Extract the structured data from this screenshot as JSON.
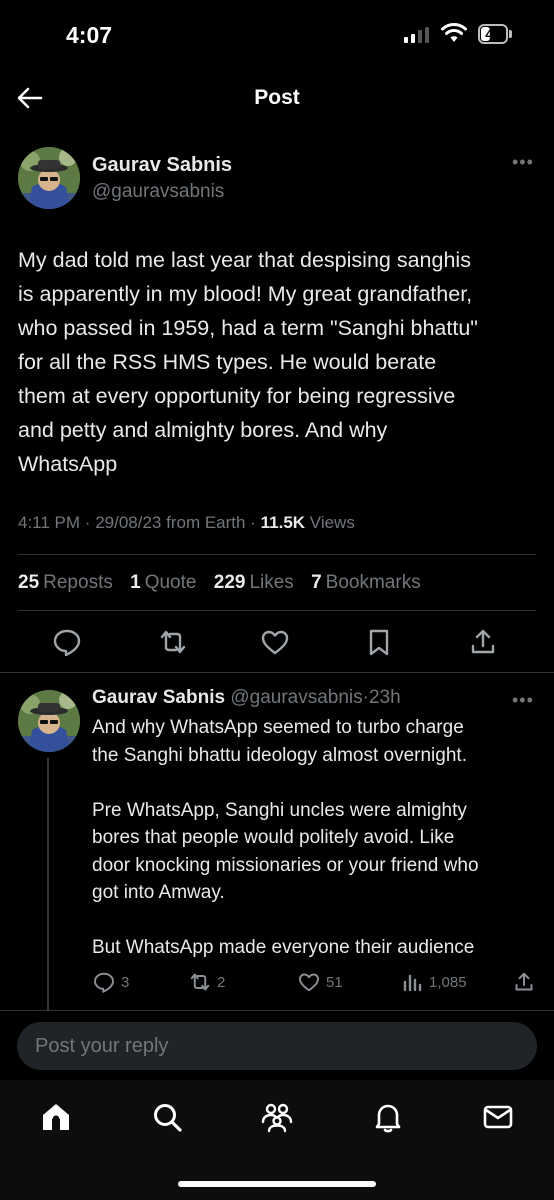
{
  "status_bar": {
    "time": "4:07",
    "battery": "44",
    "battery_level": 0.44
  },
  "header": {
    "title": "Post"
  },
  "post": {
    "author_name": "Gaurav Sabnis",
    "author_handle": "@gauravsabnis",
    "text_lines": [
      "My dad told me last year that despising sanghis",
      "is apparently in my blood! My great grandfather,",
      "who passed in 1959, had a term \"Sanghi bhattu\"",
      "for all the RSS HMS types. He would berate",
      "them at every opportunity for being regressive",
      "and petty and almighty bores. And why",
      "WhatsApp"
    ],
    "time": "4:11 PM",
    "date": "29/08/23",
    "source": "from Earth",
    "views_count": "11.5K",
    "views_label": "Views",
    "separator": "·",
    "stats": {
      "reposts_count": "25",
      "reposts_label": "Reposts",
      "quotes_count": "1",
      "quotes_label": "Quote",
      "likes_count": "229",
      "likes_label": "Likes",
      "bookmarks_count": "7",
      "bookmarks_label": "Bookmarks"
    }
  },
  "reply": {
    "author_name": "Gaurav Sabnis",
    "author_handle": "@gauravsabnis",
    "time_ago": "23h",
    "separator": "·",
    "paragraphs": [
      [
        "And why WhatsApp seemed to turbo charge",
        "the Sanghi bhattu ideology almost overnight."
      ],
      [
        "Pre WhatsApp, Sanghi uncles were almighty",
        "bores that people would politely avoid. Like",
        "door knocking missionaries or your friend who",
        "got into Amway."
      ],
      [
        "But WhatsApp made everyone their audience"
      ]
    ],
    "replies": "3",
    "reposts": "2",
    "likes": "51",
    "views": "1,085"
  },
  "reply_input": {
    "placeholder": "Post your reply"
  },
  "icons": {
    "back": "arrow-left-icon",
    "more": "more-icon",
    "reply": "comment-icon",
    "repost": "repost-icon",
    "like": "heart-icon",
    "bookmark": "bookmark-icon",
    "share": "share-icon",
    "views": "analytics-icon",
    "home": "home-icon",
    "search": "search-icon",
    "communities": "people-icon",
    "notifications": "bell-icon",
    "messages": "mail-icon"
  },
  "colors": {
    "background": "#000000",
    "text": "#e7e9ea",
    "muted": "#71767b",
    "divider": "#2f3336"
  }
}
